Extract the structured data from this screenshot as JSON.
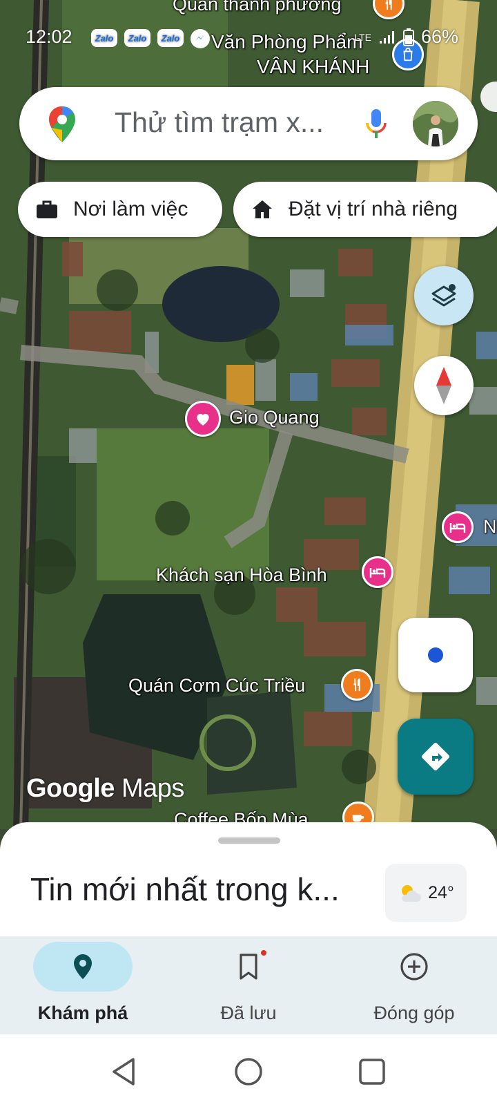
{
  "status_bar": {
    "time": "12:02",
    "notifications": [
      "Zalo",
      "Zalo",
      "Zalo"
    ],
    "network": "LTE",
    "battery": "66%"
  },
  "search": {
    "placeholder": "Thử tìm trạm x..."
  },
  "chips": {
    "work_label": "Nơi làm việc",
    "home_label": "Đặt vị trí nhà riêng"
  },
  "map": {
    "labels": {
      "top_restaurant": "Quán thành phương",
      "office_supplies_line1": "Văn Phòng Phẩm",
      "office_supplies_line2": "VÂN KHÁNH",
      "gio_quang": "Gio Quang",
      "hotel": "Khách sạn Hòa Bình",
      "hotel_edge_letter": "N",
      "rice_restaurant": "Quán Cơm Cúc Triều",
      "coffee": "Coffee Bốn Mùa"
    },
    "logo": {
      "google": "Google",
      "maps": "Maps"
    }
  },
  "bottom_sheet": {
    "title": "Tin mới nhất trong k...",
    "weather_temp": "24°"
  },
  "bottom_nav": {
    "explore": "Khám phá",
    "saved": "Đã lưu",
    "contribute": "Đóng góp"
  },
  "colors": {
    "accent_teal": "#0b7b83",
    "active_pill": "#bfe6f3",
    "poi_pink": "#e8308a",
    "poi_orange": "#ef7d1e"
  },
  "icons": [
    "maps-logo-icon",
    "mic-icon",
    "briefcase-icon",
    "home-icon",
    "layers-icon",
    "compass-icon",
    "my-location-icon",
    "directions-icon",
    "weather-icon",
    "explore-pin-icon",
    "bookmark-icon",
    "add-circle-icon",
    "back-icon",
    "home-circle-icon",
    "recents-icon"
  ]
}
